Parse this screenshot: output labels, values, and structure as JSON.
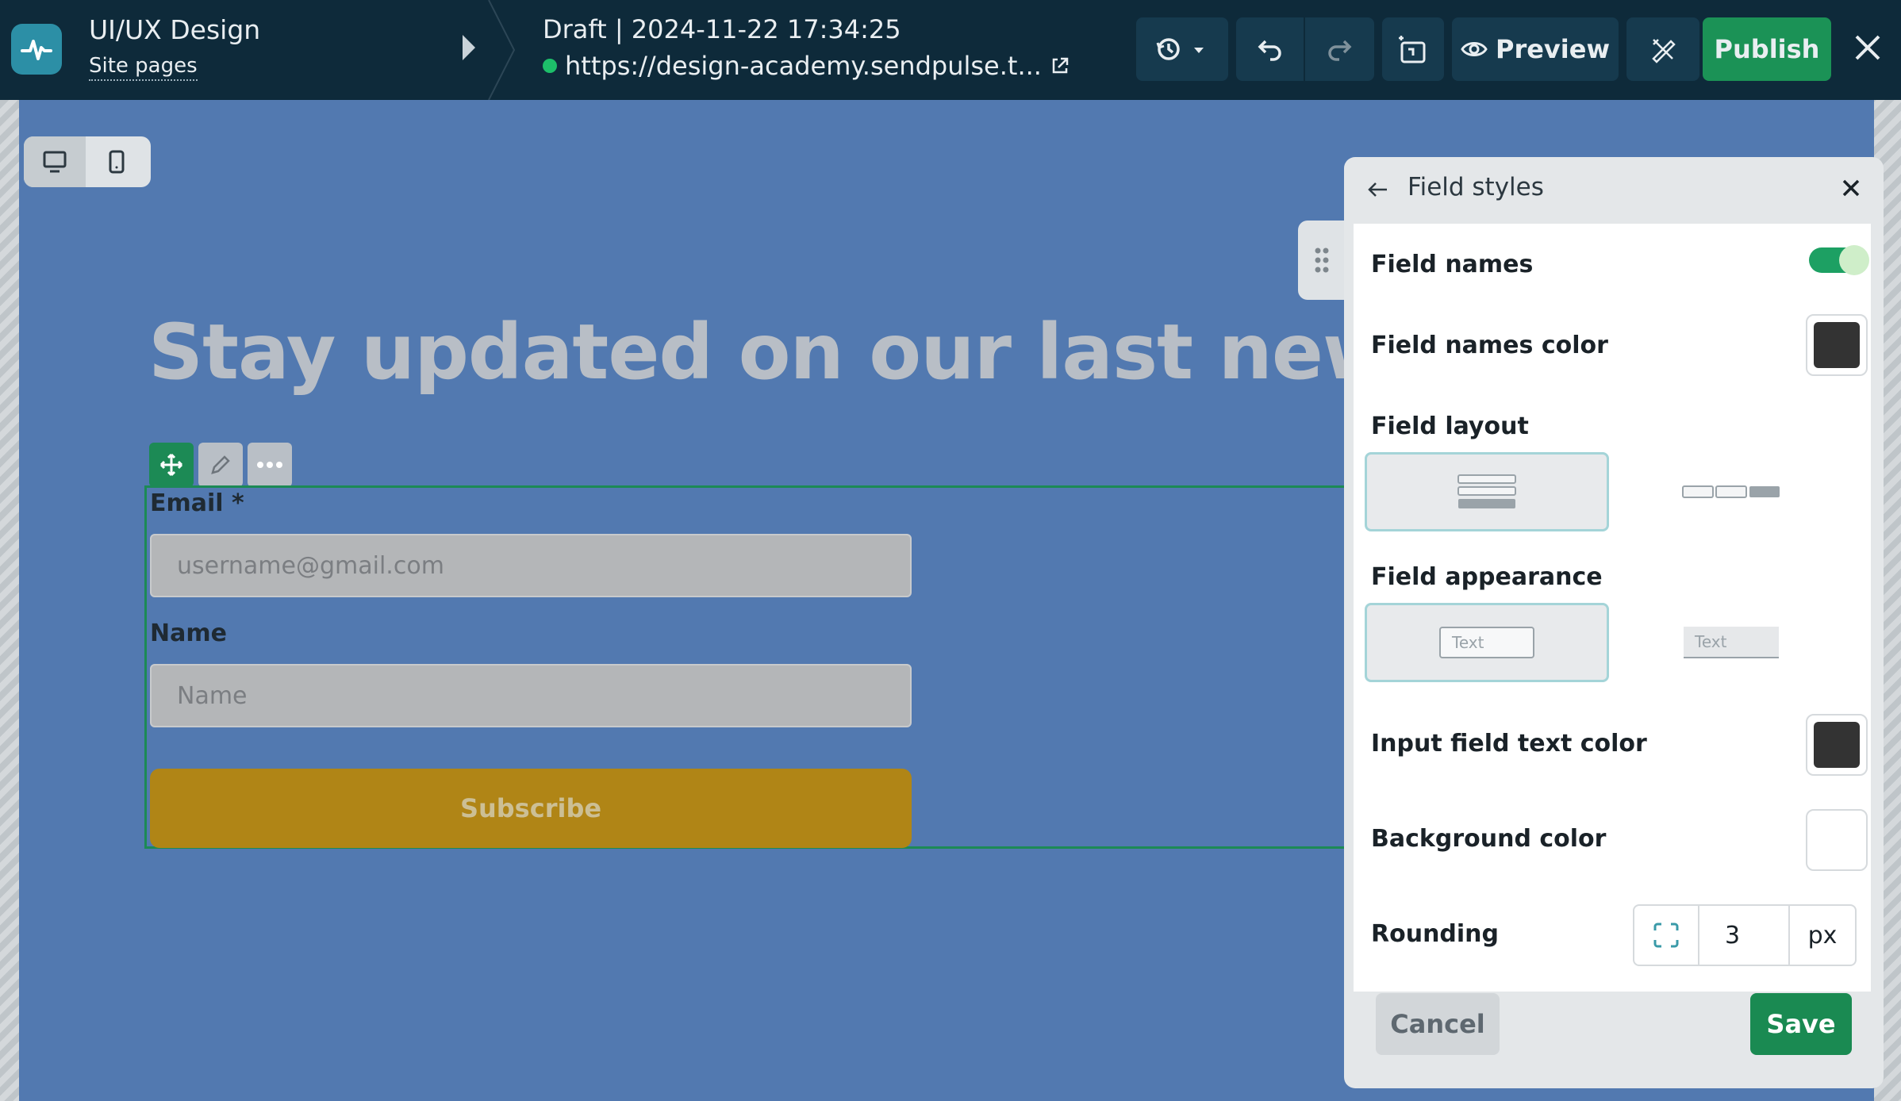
{
  "header": {
    "site_title": "UI/UX Design",
    "site_subtitle": "Site pages",
    "draft_label": "Draft | 2024-11-22 17:34:25",
    "url": "https://design-academy.sendpulse.t...",
    "preview_label": "Preview",
    "publish_label": "Publish"
  },
  "canvas": {
    "headline": "Stay updated on our last news",
    "form": {
      "email_label": "Email *",
      "email_placeholder": "username@gmail.com",
      "name_label": "Name",
      "name_placeholder": "Name",
      "subscribe_label": "Subscribe"
    }
  },
  "panel": {
    "title": "Field styles",
    "field_names_label": "Field names",
    "field_names_enabled": true,
    "field_names_color_label": "Field names color",
    "field_names_color": "#333333",
    "field_layout_label": "Field layout",
    "field_appearance_label": "Field appearance",
    "appearance_sample_1": "Text",
    "appearance_sample_2": "Text",
    "input_text_color_label": "Input field text color",
    "input_text_color": "#333333",
    "background_color_label": "Background color",
    "background_color": "#ffffff",
    "rounding_label": "Rounding",
    "rounding_value": "3",
    "rounding_unit": "px",
    "cancel_label": "Cancel",
    "save_label": "Save"
  },
  "colors": {
    "accent_green": "#1b9256",
    "topbar_bg": "#0e2a3a",
    "canvas_bg": "#5279b0",
    "subscribe_bg": "#b08516"
  }
}
